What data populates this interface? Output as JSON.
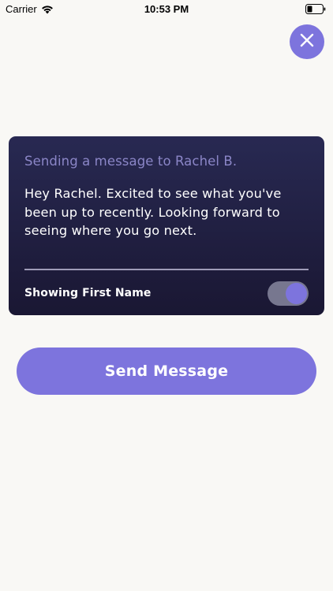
{
  "status_bar": {
    "carrier": "Carrier",
    "time": "10:53 PM",
    "wifi_icon": "wifi-icon",
    "battery_icon": "battery-icon"
  },
  "close_button": {
    "icon": "close-icon"
  },
  "card": {
    "heading": "Sending a message to Rachel B.",
    "message": "Hey Rachel. Excited to see what you've been up to recently. Looking forward to seeing where you go next.",
    "toggle_label": "Showing First Name",
    "toggle_on": true
  },
  "send_button": {
    "label": "Send Message"
  },
  "colors": {
    "accent": "#7d74dd",
    "card_background": "#1f1d40",
    "page_background": "#f9f8f5"
  }
}
